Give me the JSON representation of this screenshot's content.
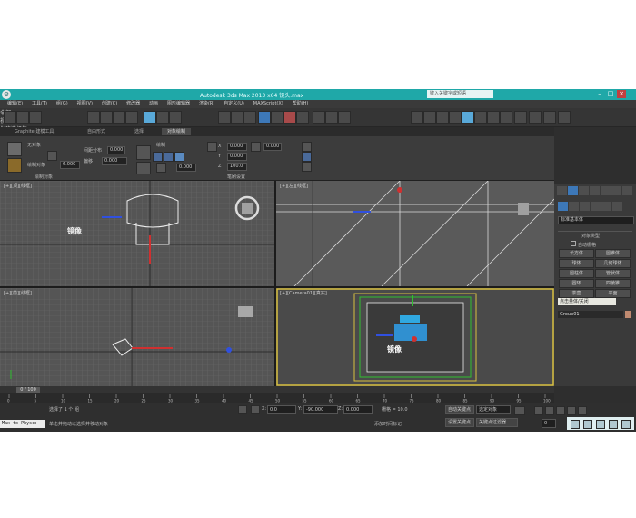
{
  "window": {
    "title": "Autodesk 3ds Max  2013 x64",
    "file": "镜头.max",
    "search_placeholder": "键入关键字或短语"
  },
  "menu": [
    "编辑(E)",
    "工具(T)",
    "组(G)",
    "视图(V)",
    "创建(C)",
    "修改器",
    "动画",
    "图形编辑器",
    "渲染(R)",
    "自定义(U)",
    "MAXScript(X)",
    "帮助(H)"
  ],
  "toolbar": {
    "selection_filter": "全部",
    "coord_system": "视图",
    "named_selection": "创建选择集"
  },
  "ribbon": {
    "tabs": [
      "Graphite 建模工具",
      "自由形式",
      "选择",
      "对象绘制"
    ],
    "active_tab": "对象绘制",
    "labels": [
      "无对象",
      "绘制对象",
      "间距分布",
      "X",
      "Y",
      "Z",
      "绘制",
      "偏移",
      "缩放"
    ],
    "field_values": [
      "6.000",
      "0.000",
      "0.000",
      "0.000",
      "0.000",
      "0.000",
      "100.0",
      "0.000"
    ],
    "section_labels": [
      "绘制对象",
      "笔刷设置"
    ]
  },
  "viewports": {
    "top_left": "[+][顶][线框]",
    "top_right": "[+][左][线框]",
    "bottom_left": "[+][前][线框]",
    "bottom_right": "[+][Camera01][真实]",
    "labels": [
      "镜像",
      "镜像"
    ]
  },
  "command_panel": {
    "dropdown": "标准基本体",
    "rollout_title": "对象类型",
    "autogrid": "自动栅格",
    "buttons": [
      "长方体",
      "圆锥体",
      "球体",
      "几何球体",
      "圆柱体",
      "管状体",
      "圆环",
      "四棱锥",
      "茶壶",
      "平面"
    ],
    "tooltip": "点击量体/关闭",
    "name_rollout": "Group01"
  },
  "timeline": {
    "frame": "0 / 100",
    "ticks": [
      "0",
      "5",
      "10",
      "15",
      "20",
      "25",
      "30",
      "35",
      "40",
      "45",
      "50",
      "55",
      "60",
      "65",
      "70",
      "75",
      "80",
      "85",
      "90",
      "95",
      "100"
    ]
  },
  "status": {
    "maxscript": "Max to Physc:",
    "selection": "选择了 1 个 组",
    "prompt": "单击并拖动以选择并移动对象",
    "x_label": "X:",
    "x_value": "0.0",
    "y_label": "Y:",
    "y_value": "-90.000",
    "z_label": "Z:",
    "z_value": "0.000",
    "grid": "栅格 = 10.0",
    "autokey": "自动关键点",
    "selected": "选定对象",
    "set_key": "设置关键点",
    "key_filter": "关键点过滤器...",
    "add_time_tag": "添加时间标记",
    "time_value": "0"
  },
  "colors": {
    "title_bar": "#1fa8a8",
    "x_axis": "#d03030",
    "y_axis": "#30c030",
    "z_axis": "#3050e0",
    "active_border": "#d8c040"
  }
}
